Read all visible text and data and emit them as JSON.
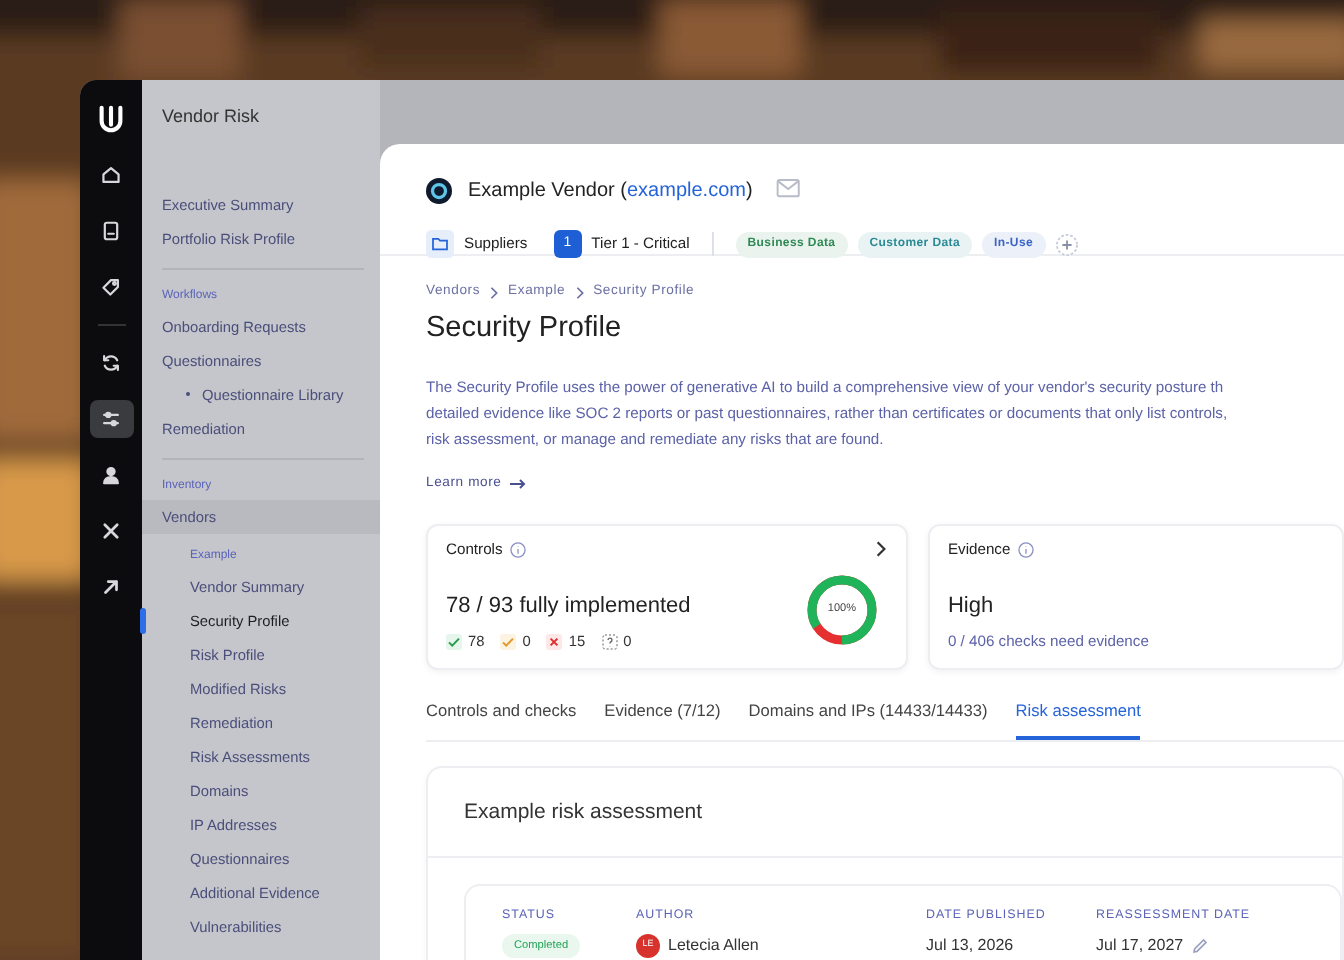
{
  "app": {
    "title": "Vendor Risk"
  },
  "rail": [
    {
      "kind": "logo",
      "selected": false
    },
    {
      "kind": "home",
      "selected": false
    },
    {
      "kind": "document",
      "selected": false
    },
    {
      "kind": "tag",
      "selected": false
    },
    {
      "kind": "refresh",
      "selected": false
    },
    {
      "kind": "sliders",
      "selected": true
    },
    {
      "kind": "person",
      "selected": false
    },
    {
      "kind": "close",
      "selected": false
    },
    {
      "kind": "arrow",
      "selected": false
    }
  ],
  "sidebar": {
    "sections": [
      {
        "items": [
          {
            "label": "Executive Summary",
            "selected": false,
            "expanded": false
          },
          {
            "label": "Portfolio Risk Profile",
            "selected": false,
            "expanded": false
          }
        ]
      },
      {
        "heading": "Workflows",
        "items": [
          {
            "label": "Onboarding Requests",
            "selected": false,
            "expanded": false
          },
          {
            "label": "Questionnaires",
            "selected": false,
            "expanded": false,
            "children": [
              {
                "label": "Questionnaire Library",
                "selected": false
              }
            ]
          },
          {
            "label": "Remediation",
            "selected": false,
            "expanded": false
          }
        ]
      },
      {
        "heading": "Inventory",
        "items": [
          {
            "label": "Vendors",
            "selected": false,
            "expanded": true,
            "group": "Example",
            "children": [
              {
                "label": "Vendor Summary",
                "selected": false
              },
              {
                "label": "Security Profile",
                "selected": true
              },
              {
                "label": "Risk Profile",
                "selected": false
              },
              {
                "label": "Modified Risks",
                "selected": false
              },
              {
                "label": "Remediation",
                "selected": false
              },
              {
                "label": "Risk Assessments",
                "selected": false
              },
              {
                "label": "Domains",
                "selected": false
              },
              {
                "label": "IP Addresses",
                "selected": false
              },
              {
                "label": "Questionnaires",
                "selected": false
              },
              {
                "label": "Additional Evidence",
                "selected": false
              },
              {
                "label": "Vulnerabilities",
                "selected": false
              }
            ]
          }
        ]
      }
    ]
  },
  "vendor": {
    "name": "Example Vendor",
    "domain_open": "(",
    "domain": "example.com",
    "domain_close": ")",
    "category": "Suppliers",
    "tier_badge": "1",
    "tier": "Tier 1 - Critical",
    "tags": [
      {
        "label": "Business Data",
        "color": "#2e8a55"
      },
      {
        "label": "Customer Data",
        "color": "#2a8a94"
      },
      {
        "label": "In-Use",
        "color": "#3b64c4"
      }
    ]
  },
  "breadcrumb": [
    "Vendors",
    "Example",
    "Security Profile"
  ],
  "title": "Security Profile",
  "description": [
    "The Security Profile uses the power of generative AI to build a comprehensive view of your vendor's security posture th",
    "detailed evidence like SOC 2 reports or past questionnaires, rather than certificates or documents that only list controls,",
    "risk assessment, or manage and remediate any risks that are found."
  ],
  "learn_more": "Learn more",
  "controls": {
    "title": "Controls",
    "summary": "78 / 93 fully implemented",
    "level": 0.84,
    "ring_label": "100%",
    "counts": [
      {
        "kind": "pass",
        "value": "78"
      },
      {
        "kind": "partial",
        "value": "0"
      },
      {
        "kind": "fail",
        "value": "15"
      },
      {
        "kind": "unknown",
        "value": "0"
      }
    ]
  },
  "evidence": {
    "title": "Evidence",
    "summary": "High",
    "detail": "0 / 406 checks need evidence"
  },
  "tabs": [
    {
      "label": "Controls and checks",
      "selected": false
    },
    {
      "label": "Evidence (7/12)",
      "selected": false
    },
    {
      "label": "Domains and IPs (14433/14433)",
      "selected": false
    },
    {
      "label": "Risk assessment",
      "selected": true
    }
  ],
  "assessment": {
    "title": "Example risk assessment",
    "columns": [
      "STATUS",
      "AUTHOR",
      "DATE PUBLISHED",
      "REASSESSMENT DATE"
    ],
    "row": {
      "status": "Completed",
      "author_initials": "LE",
      "author": "Letecia Allen",
      "published": "Jul 13, 2026",
      "reassessment": "Jul 17, 2027"
    }
  }
}
